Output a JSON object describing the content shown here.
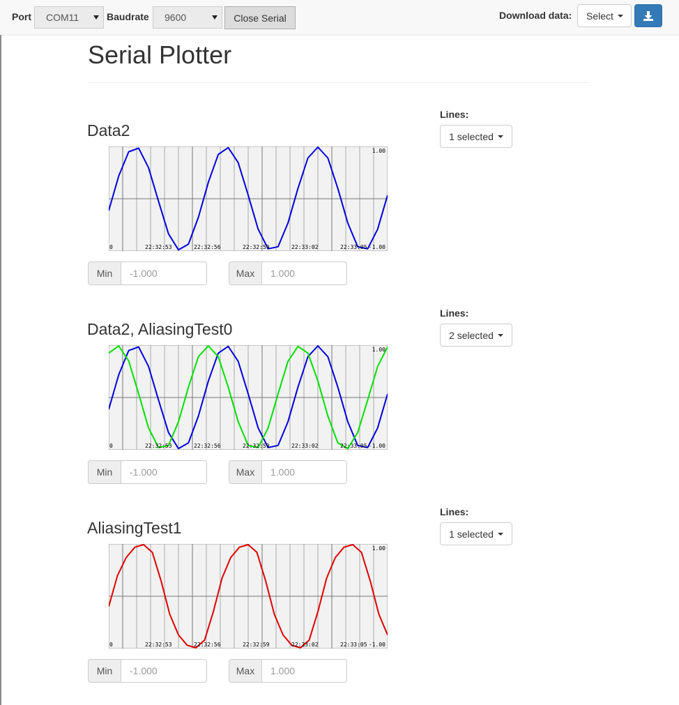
{
  "toolbar": {
    "port_label": "Port",
    "port_value": "COM11",
    "baudrate_label": "Baudrate",
    "baudrate_value": "9600",
    "close_serial_label": "Close Serial",
    "download_label": "Download data:",
    "download_select": "Select",
    "download_icon": "download-icon"
  },
  "page_title": "Serial Plotter",
  "colors": {
    "blue": "#0000dd",
    "green": "#00e000",
    "red": "#e00000",
    "accent": "#337ab7"
  },
  "plots": [
    {
      "title": "Data2",
      "lines_label": "Lines:",
      "lines_selected": "1 selected",
      "min_label": "Min",
      "min_placeholder": "-1.000",
      "max_label": "Max",
      "max_placeholder": "1.000",
      "y_max_label": "1.00",
      "y_min_label": "-1.00",
      "x_tick_labels": [
        "0",
        "22:32:53",
        "22:32:56",
        "22:32:59",
        "22:33:02",
        "22:33:05"
      ]
    },
    {
      "title": "Data2, AliasingTest0",
      "lines_label": "Lines:",
      "lines_selected": "2 selected",
      "min_label": "Min",
      "min_placeholder": "-1.000",
      "max_label": "Max",
      "max_placeholder": "1.000",
      "y_max_label": "1.00",
      "y_min_label": "-1.00",
      "x_tick_labels": [
        "0",
        "22:32:53",
        "22:32:56",
        "22:32:59",
        "22:33:02",
        "22:33:05"
      ]
    },
    {
      "title": "AliasingTest1",
      "lines_label": "Lines:",
      "lines_selected": "1 selected",
      "min_label": "Min",
      "min_placeholder": "-1.000",
      "max_label": "Max",
      "max_placeholder": "1.000",
      "y_max_label": "1.00",
      "y_min_label": "-1.00",
      "x_tick_labels": [
        "0",
        "22:32:53",
        "22:32:56",
        "22:32:59",
        "22:33:02",
        "22:33:05"
      ]
    }
  ],
  "chart_data": [
    {
      "type": "line",
      "ylim": [
        -1,
        1
      ],
      "grid": true,
      "series": [
        {
          "color": "#0000dd",
          "values": [
            -0.23,
            0.44,
            0.91,
            0.98,
            0.6,
            -0.05,
            -0.68,
            -0.99,
            -0.88,
            -0.36,
            0.32,
            0.86,
            0.99,
            0.7,
            0.07,
            -0.59,
            -0.97,
            -0.93,
            -0.47,
            0.2,
            0.79,
            1,
            0.79,
            0.2,
            -0.47,
            -0.93,
            -0.97,
            -0.59,
            0.07
          ]
        }
      ]
    },
    {
      "type": "line",
      "ylim": [
        -1,
        1
      ],
      "grid": true,
      "series": [
        {
          "color": "#0000dd",
          "values": [
            -0.23,
            0.44,
            0.91,
            0.98,
            0.6,
            -0.05,
            -0.68,
            -0.99,
            -0.88,
            -0.36,
            0.32,
            0.86,
            0.99,
            0.7,
            0.07,
            -0.59,
            -0.97,
            -0.93,
            -0.47,
            0.2,
            0.79,
            1,
            0.79,
            0.2,
            -0.47,
            -0.93,
            -0.97,
            -0.59,
            0.07
          ]
        },
        {
          "color": "#00e000",
          "values": [
            0.86,
            1,
            0.71,
            0.07,
            -0.59,
            -0.97,
            -0.93,
            -0.47,
            0.2,
            0.79,
            1,
            0.79,
            0.2,
            -0.47,
            -0.93,
            -0.97,
            -0.59,
            0.07,
            0.7,
            0.99,
            0.86,
            0.32,
            -0.36,
            -0.88,
            -0.99,
            -0.68,
            -0.05,
            0.6,
            0.98
          ]
        }
      ]
    },
    {
      "type": "line",
      "ylim": [
        -1,
        1
      ],
      "grid": true,
      "series": [
        {
          "color": "#e00000",
          "values": [
            -0.2,
            0.4,
            0.75,
            0.95,
            1,
            0.85,
            0.3,
            -0.35,
            -0.75,
            -0.95,
            -1,
            -0.85,
            -0.3,
            0.35,
            0.75,
            0.95,
            1,
            0.85,
            0.3,
            -0.35,
            -0.75,
            -0.95,
            -1,
            -0.85,
            -0.3,
            0.35,
            0.75,
            0.95,
            1,
            0.85,
            0.3,
            -0.35,
            -0.75
          ]
        }
      ]
    }
  ]
}
